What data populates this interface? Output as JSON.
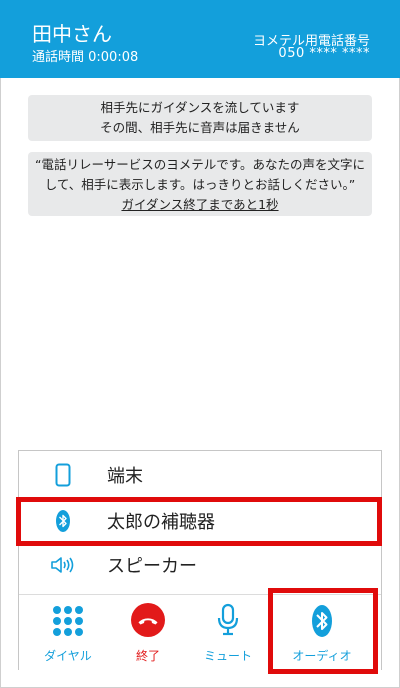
{
  "header": {
    "caller_name": "田中さん",
    "call_time": "通話時間 0:00:08",
    "number_label": "ヨメテル用電話番号",
    "number_value": "050 **** ****"
  },
  "messages": [
    {
      "line1": "相手先にガイダンスを流しています",
      "line2": "その間、相手先に音声は届きません"
    },
    {
      "line1": "“電話リレーサービスのヨメテルです。あなたの声を文字に",
      "line2": "して、相手に表示します。はっきりとお話しください。”",
      "sub": "ガイダンス終了まであと1秒"
    }
  ],
  "audio_options": [
    {
      "label": "端末",
      "icon": "phone-device-icon"
    },
    {
      "label": "太郎の補聴器",
      "icon": "bluetooth-icon",
      "highlighted": true
    },
    {
      "label": "スピーカー",
      "icon": "speaker-icon"
    }
  ],
  "toolbar": {
    "dial": "ダイヤル",
    "end": "終了",
    "mute": "ミュート",
    "audio": "オーディオ"
  },
  "colors": {
    "accent": "#139fdb",
    "end_red": "#e21a1a",
    "highlight": "#e00b0b"
  }
}
